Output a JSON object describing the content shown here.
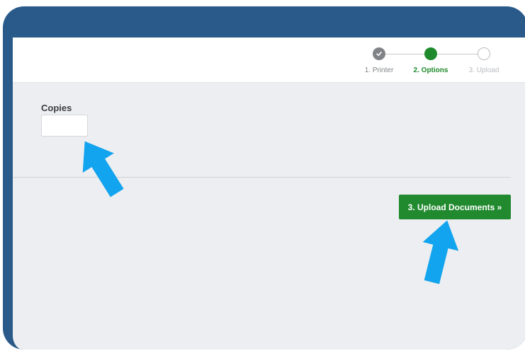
{
  "stepper": {
    "steps": [
      {
        "label": "1. Printer",
        "state": "done"
      },
      {
        "label": "2. Options",
        "state": "active"
      },
      {
        "label": "3. Upload",
        "state": "pending"
      }
    ]
  },
  "form": {
    "copies_label": "Copies",
    "copies_value": ""
  },
  "actions": {
    "upload_label": "3. Upload Documents »"
  },
  "colors": {
    "frame": "#2a5a8a",
    "panel": "#eceef1",
    "active_green": "#1f8a2c",
    "done_gray": "#808387",
    "arrow_blue": "#12a4ee"
  },
  "icons": {
    "done_step": "checkmark-icon",
    "annotation": "arrow-pointer-icon"
  }
}
